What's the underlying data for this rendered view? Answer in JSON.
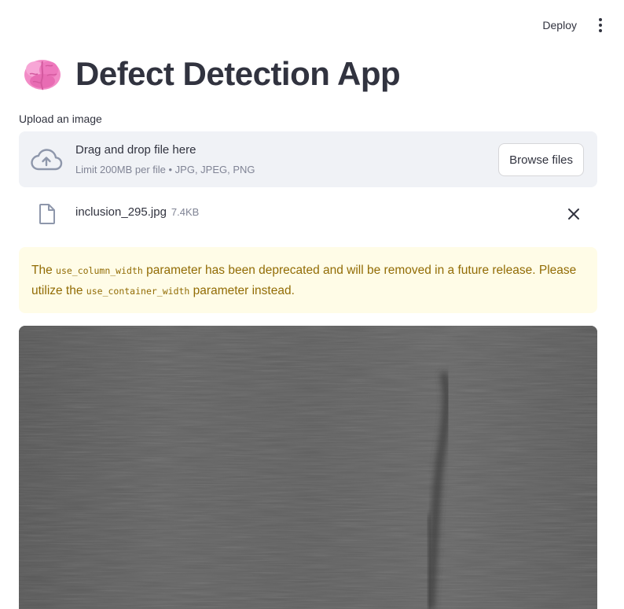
{
  "toolbar": {
    "deploy_label": "Deploy",
    "menu_icon": "kebab-menu-icon"
  },
  "header": {
    "icon": "brain-emoji",
    "title": "Defect Detection App"
  },
  "uploader": {
    "label": "Upload an image",
    "drop_title": "Drag and drop file here",
    "drop_subtitle": "Limit 200MB per file • JPG, JPEG, PNG",
    "browse_label": "Browse files",
    "icon": "cloud-upload-icon"
  },
  "uploaded_file": {
    "name": "inclusion_295.jpg",
    "size": "7.4KB",
    "icon": "file-icon",
    "remove_icon": "close-icon"
  },
  "warning": {
    "text_1": "The ",
    "code_1": "use_column_width",
    "text_2": " parameter has been deprecated and will be removed in a future release. Please utilize the ",
    "code_2": "use_container_width",
    "text_3": " parameter instead."
  },
  "colors": {
    "text": "#31333f",
    "muted": "#808495",
    "dropzone_bg": "#f0f2f6",
    "warning_bg": "#fffce7",
    "warning_text": "#926c05"
  }
}
